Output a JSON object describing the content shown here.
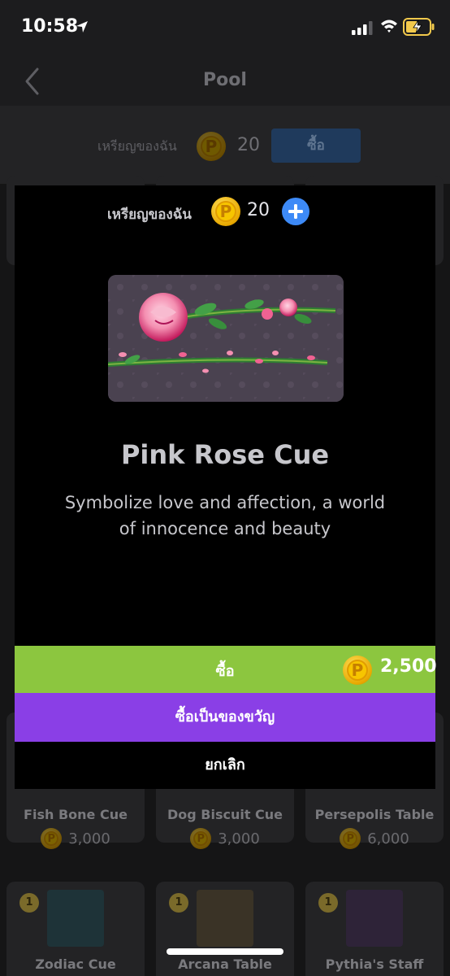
{
  "status_bar": {
    "time": "10:58"
  },
  "nav": {
    "title": "Pool"
  },
  "coin_header": {
    "label": "เหรียญของฉัน",
    "amount": "20",
    "buy_label": "ซื้อ",
    "coin_glyph": "P"
  },
  "grid": {
    "cards": [
      {
        "name": "Fish Bone Cue",
        "price": "3,000",
        "color": "#2a2a2c"
      },
      {
        "name": "Dog Biscuit Cue",
        "price": "3,000",
        "color": "#3a3022"
      },
      {
        "name": "Persepolis Table",
        "price": "6,000",
        "color": "#3a2a2a"
      },
      {
        "name": "Zodiac Cue",
        "price": "",
        "badge": "1",
        "color": "#1e3338"
      },
      {
        "name": "Arcana Table",
        "price": "",
        "badge": "1",
        "color": "#3a3326"
      },
      {
        "name": "Pythia's Staff",
        "price": "",
        "badge": "1",
        "color": "#2e2338"
      }
    ]
  },
  "modal": {
    "coins_label": "เหรียญของฉัน",
    "coins_amount": "20",
    "coin_glyph": "P",
    "title": "Pink Rose Cue",
    "description": "Symbolize love and affection, a world of innocence and beauty",
    "buy_label": "ซื้อ",
    "buy_price": "2,500",
    "gift_label": "ซื้อเป็นของขวัญ",
    "cancel_label": "ยกเลิก"
  },
  "colors": {
    "buy": "#8cc63f",
    "gift": "#8a3fe6",
    "accent_blue": "#3d8af7"
  }
}
